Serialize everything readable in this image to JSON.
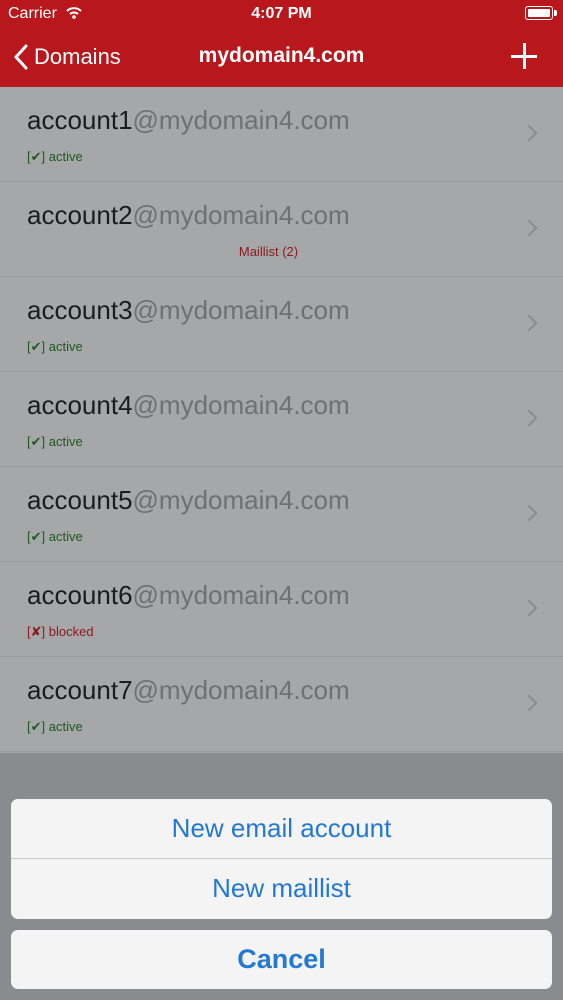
{
  "status_bar": {
    "carrier": "Carrier",
    "time": "4:07 PM"
  },
  "nav": {
    "back_label": "Domains",
    "title": "mydomain4.com"
  },
  "accounts": [
    {
      "user": "account1",
      "domain": "@mydomain4.com",
      "status_mark": "[✔]",
      "status": "active",
      "tag": ""
    },
    {
      "user": "account2",
      "domain": "@mydomain4.com",
      "status_mark": "",
      "status": "",
      "tag": "Maillist (2)"
    },
    {
      "user": "account3",
      "domain": "@mydomain4.com",
      "status_mark": "[✔]",
      "status": "active",
      "tag": ""
    },
    {
      "user": "account4",
      "domain": "@mydomain4.com",
      "status_mark": "[✔]",
      "status": "active",
      "tag": ""
    },
    {
      "user": "account5",
      "domain": "@mydomain4.com",
      "status_mark": "[✔]",
      "status": "active",
      "tag": ""
    },
    {
      "user": "account6",
      "domain": "@mydomain4.com",
      "status_mark": "[✘]",
      "status": "blocked",
      "tag": ""
    },
    {
      "user": "account7",
      "domain": "@mydomain4.com",
      "status_mark": "[✔]",
      "status": "active",
      "tag": ""
    }
  ],
  "action_sheet": {
    "new_account": "New email account",
    "new_maillist": "New maillist",
    "cancel": "Cancel"
  },
  "colors": {
    "nav": "#b8171c",
    "action_text": "#2378d3",
    "active": "#1e5a1e",
    "blocked": "#8b1a1a"
  }
}
